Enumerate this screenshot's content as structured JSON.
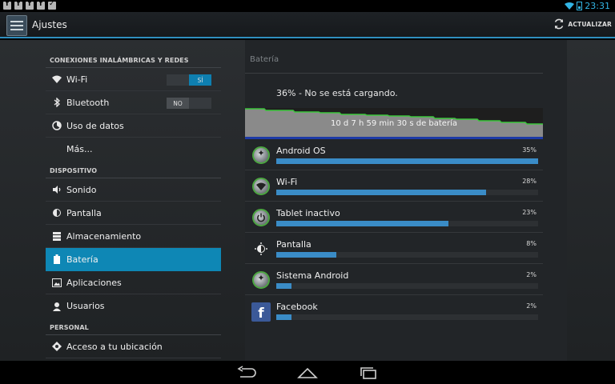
{
  "status_bar": {
    "time": "23:31",
    "notification_icons": [
      "facebook-icon",
      "facebook-icon",
      "facebook-icon",
      "facebook-icon",
      "checklist-icon"
    ]
  },
  "action_bar": {
    "title": "Ajustes",
    "refresh_label": "ACTUALIZAR"
  },
  "sidebar": {
    "sections": [
      {
        "header": "CONEXIONES INALÁMBRICAS Y REDES",
        "items": [
          {
            "label": "Wi-Fi",
            "icon": "wifi-icon",
            "toggle": "SÍ"
          },
          {
            "label": "Bluetooth",
            "icon": "bluetooth-icon",
            "toggle": "NO"
          },
          {
            "label": "Uso de datos",
            "icon": "data-usage-icon"
          },
          {
            "label": "Más..."
          }
        ]
      },
      {
        "header": "DISPOSITIVO",
        "items": [
          {
            "label": "Sonido",
            "icon": "volume-icon"
          },
          {
            "label": "Pantalla",
            "icon": "brightness-icon"
          },
          {
            "label": "Almacenamiento",
            "icon": "storage-icon"
          },
          {
            "label": "Batería",
            "icon": "battery-icon",
            "selected": true
          },
          {
            "label": "Aplicaciones",
            "icon": "apps-icon"
          },
          {
            "label": "Usuarios",
            "icon": "users-icon"
          }
        ]
      },
      {
        "header": "PERSONAL",
        "items": [
          {
            "label": "Acceso a tu ubicación",
            "icon": "location-icon"
          }
        ]
      }
    ]
  },
  "battery": {
    "title": "Batería",
    "status": "36% - No se está cargando.",
    "graph_label": "10 d 7 h 59 min 30 s de batería",
    "usage": [
      {
        "name": "Android OS",
        "percent_label": "35%",
        "percent": 35,
        "icon": "android-icon"
      },
      {
        "name": "Wi-Fi",
        "percent_label": "28%",
        "percent": 28,
        "icon": "wifi-app-icon"
      },
      {
        "name": "Tablet inactivo",
        "percent_label": "23%",
        "percent": 23,
        "icon": "power-icon"
      },
      {
        "name": "Pantalla",
        "percent_label": "8%",
        "percent": 8,
        "icon": "screen-brightness-icon"
      },
      {
        "name": "Sistema Android",
        "percent_label": "2%",
        "percent": 2,
        "icon": "android-system-icon"
      },
      {
        "name": "Facebook",
        "percent_label": "2%",
        "percent": 2,
        "icon": "facebook-icon"
      }
    ]
  },
  "nav_bar": {
    "buttons": [
      "back-icon",
      "home-icon",
      "recents-icon"
    ]
  },
  "colors": {
    "accent": "#33b5e5",
    "selected": "#0e87b5",
    "bar_fill": "#3a8cc7",
    "graph_line": "#3cc83c"
  }
}
